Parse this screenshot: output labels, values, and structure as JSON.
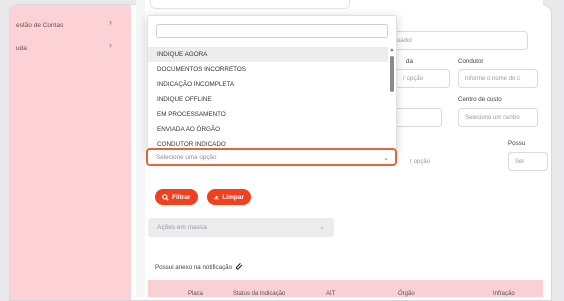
{
  "sidebar": {
    "items": [
      {
        "label": "estão de Contas"
      },
      {
        "label": "uda"
      }
    ]
  },
  "form": {
    "orgao_autuador_placeholder": "rgão autuador",
    "label_condutor": "Condutor",
    "label_partial_da": "da",
    "condutor_placeholder": "Informe o nome do c",
    "opcao_partial_1": "r opção",
    "label_centro_custo": "Centro de custo",
    "centro_custo_placeholder": "Selecione um centro",
    "label_partial_possu": "Possu",
    "opcao_partial_2": "r opção",
    "partial_sel": "Sel"
  },
  "dropdown": {
    "search_value": "",
    "options": [
      {
        "label": "INDIQUE AGORA"
      },
      {
        "label": "DOCUMENTOS INCORRETOS"
      },
      {
        "label": "INDICAÇÃO INCOMPLETA"
      },
      {
        "label": "INDIQUE OFFLINE"
      },
      {
        "label": "EM PROCESSAMENTO"
      },
      {
        "label": "ENVIADA AO ÓRGÃO"
      },
      {
        "label": "CONDUTOR INDICADO"
      }
    ],
    "selected_placeholder": "Selecione uma opção"
  },
  "buttons": {
    "filter_label": "Filtrar",
    "clear_label": "Limpar"
  },
  "bulk_actions": {
    "label": "Ações em massa"
  },
  "attachment_filter": {
    "label": "Possui anexo na notificação"
  },
  "table": {
    "headers": [
      "Placa",
      "Status da indicação",
      "AIT",
      "Órgão",
      "Infração"
    ]
  },
  "colors": {
    "accent": "#f2401f",
    "sidebar_bg": "#fdd2d6",
    "focus_border": "#e8633a"
  }
}
